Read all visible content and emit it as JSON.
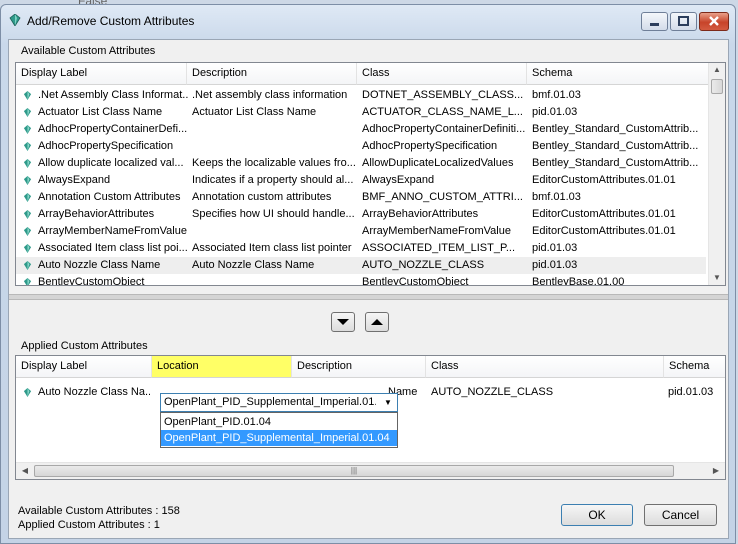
{
  "background_text": "False",
  "window": {
    "title": "Add/Remove Custom Attributes"
  },
  "available": {
    "group_label": "Available Custom Attributes",
    "columns": [
      "Display Label",
      "Description",
      "Class",
      "Schema"
    ],
    "rows": [
      [
        ".Net Assembly Class Informat...",
        ".Net assembly class information",
        "DOTNET_ASSEMBLY_CLASS...",
        "bmf.01.03"
      ],
      [
        "Actuator List Class Name",
        "Actuator List Class Name",
        "ACTUATOR_CLASS_NAME_L...",
        "pid.01.03"
      ],
      [
        "AdhocPropertyContainerDefi...",
        "",
        "AdhocPropertyContainerDefiniti...",
        "Bentley_Standard_CustomAttrib..."
      ],
      [
        "AdhocPropertySpecification",
        "",
        "AdhocPropertySpecification",
        "Bentley_Standard_CustomAttrib..."
      ],
      [
        "Allow duplicate localized val...",
        "Keeps the localizable values fro...",
        "AllowDuplicateLocalizedValues",
        "Bentley_Standard_CustomAttrib..."
      ],
      [
        "AlwaysExpand",
        "Indicates if a property should al...",
        "AlwaysExpand",
        "EditorCustomAttributes.01.01"
      ],
      [
        "Annotation Custom Attributes",
        "Annotation custom attributes",
        "BMF_ANNO_CUSTOM_ATTRI...",
        "bmf.01.03"
      ],
      [
        "ArrayBehaviorAttributes",
        "Specifies how UI should handle...",
        "ArrayBehaviorAttributes",
        "EditorCustomAttributes.01.01"
      ],
      [
        "ArrayMemberNameFromValue",
        "",
        "ArrayMemberNameFromValue",
        "EditorCustomAttributes.01.01"
      ],
      [
        "Associated Item class list poi...",
        "Associated Item class list pointer",
        "ASSOCIATED_ITEM_LIST_P...",
        "pid.01.03"
      ],
      [
        "Auto Nozzle Class Name",
        "Auto Nozzle Class Name",
        "AUTO_NOZZLE_CLASS",
        "pid.01.03"
      ],
      [
        "BentleyCustomObject",
        "",
        "BentleyCustomObject",
        "BentleyBase.01.00"
      ]
    ],
    "selected_row": 10
  },
  "move_down_icon": "triangle-down-icon",
  "move_up_icon": "triangle-up-icon",
  "applied": {
    "group_label": "Applied Custom Attributes",
    "columns": [
      "Display Label",
      "Location",
      "Description",
      "Class",
      "Schema"
    ],
    "row": {
      "display_label": "Auto Nozzle Class Na...",
      "location": "OpenPlant_PID_Supplemental_Imperial.01.04",
      "description_tail": "Name",
      "class": "AUTO_NOZZLE_CLASS",
      "schema": "pid.01.03"
    },
    "dropdown_options": [
      "OpenPlant_PID.01.04",
      "OpenPlant_PID_Supplemental_Imperial.01.04"
    ],
    "highlight_color": "#ffff66"
  },
  "status": {
    "available_count": "Available Custom Attributes : 158",
    "applied_count": "Applied Custom Attributes : 1"
  },
  "buttons": {
    "ok": "OK",
    "cancel": "Cancel"
  },
  "colors": {
    "selection": "#3399ff",
    "close_button": "#c7442a"
  }
}
